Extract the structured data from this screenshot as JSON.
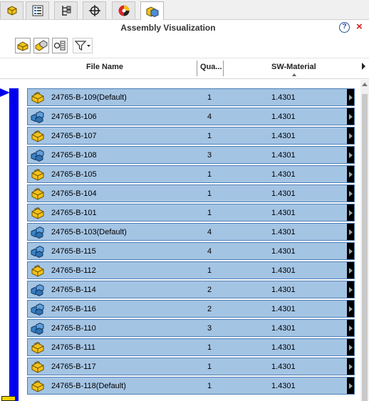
{
  "tabs": [
    {
      "icon": "feature-manager-icon",
      "active": false
    },
    {
      "icon": "property-manager-icon",
      "active": false
    },
    {
      "icon": "configuration-manager-icon",
      "active": false
    },
    {
      "icon": "dimxpert-manager-icon",
      "active": false
    },
    {
      "icon": "display-manager-icon",
      "active": false
    },
    {
      "icon": "assembly-visualization-icon",
      "active": true
    }
  ],
  "panel": {
    "title": "Assembly Visualization",
    "help_icon": "?",
    "close_icon": "×"
  },
  "toolbar": {
    "buttons": [
      "part-icon",
      "parts-group-icon",
      "list-icon"
    ],
    "filter_icon": "filter-icon"
  },
  "columns": {
    "file_name": "File Name",
    "quantity": "Qua...",
    "material": "SW-Material"
  },
  "colors": {
    "row_fill": "#a4c4e4",
    "row_border": "#4d7fb6",
    "indicator_bar": "#0000ee",
    "part_icon": "#f3c21a",
    "assembly_icon": "#3b82c4"
  },
  "rows": [
    {
      "name": "24765-B-109(Default)",
      "qty": "1",
      "material": "1.4301",
      "icon": "part-icon"
    },
    {
      "name": "24765-B-106",
      "qty": "4",
      "material": "1.4301",
      "icon": "assembly-icon"
    },
    {
      "name": "24765-B-107",
      "qty": "1",
      "material": "1.4301",
      "icon": "part-icon"
    },
    {
      "name": "24765-B-108",
      "qty": "3",
      "material": "1.4301",
      "icon": "assembly-icon"
    },
    {
      "name": "24765-B-105",
      "qty": "1",
      "material": "1.4301",
      "icon": "part-icon"
    },
    {
      "name": "24765-B-104",
      "qty": "1",
      "material": "1.4301",
      "icon": "part-icon"
    },
    {
      "name": "24765-B-101",
      "qty": "1",
      "material": "1.4301",
      "icon": "part-icon"
    },
    {
      "name": "24765-B-103(Default)",
      "qty": "4",
      "material": "1.4301",
      "icon": "assembly-icon"
    },
    {
      "name": "24765-B-115",
      "qty": "4",
      "material": "1.4301",
      "icon": "assembly-icon"
    },
    {
      "name": "24765-B-112",
      "qty": "1",
      "material": "1.4301",
      "icon": "part-icon"
    },
    {
      "name": "24765-B-114",
      "qty": "2",
      "material": "1.4301",
      "icon": "assembly-icon"
    },
    {
      "name": "24765-B-116",
      "qty": "2",
      "material": "1.4301",
      "icon": "assembly-icon"
    },
    {
      "name": "24765-B-110",
      "qty": "3",
      "material": "1.4301",
      "icon": "assembly-icon"
    },
    {
      "name": "24765-B-111",
      "qty": "1",
      "material": "1.4301",
      "icon": "part-icon"
    },
    {
      "name": "24765-B-117",
      "qty": "1",
      "material": "1.4301",
      "icon": "part-icon"
    },
    {
      "name": "24765-B-118(Default)",
      "qty": "1",
      "material": "1.4301",
      "icon": "part-icon"
    }
  ]
}
